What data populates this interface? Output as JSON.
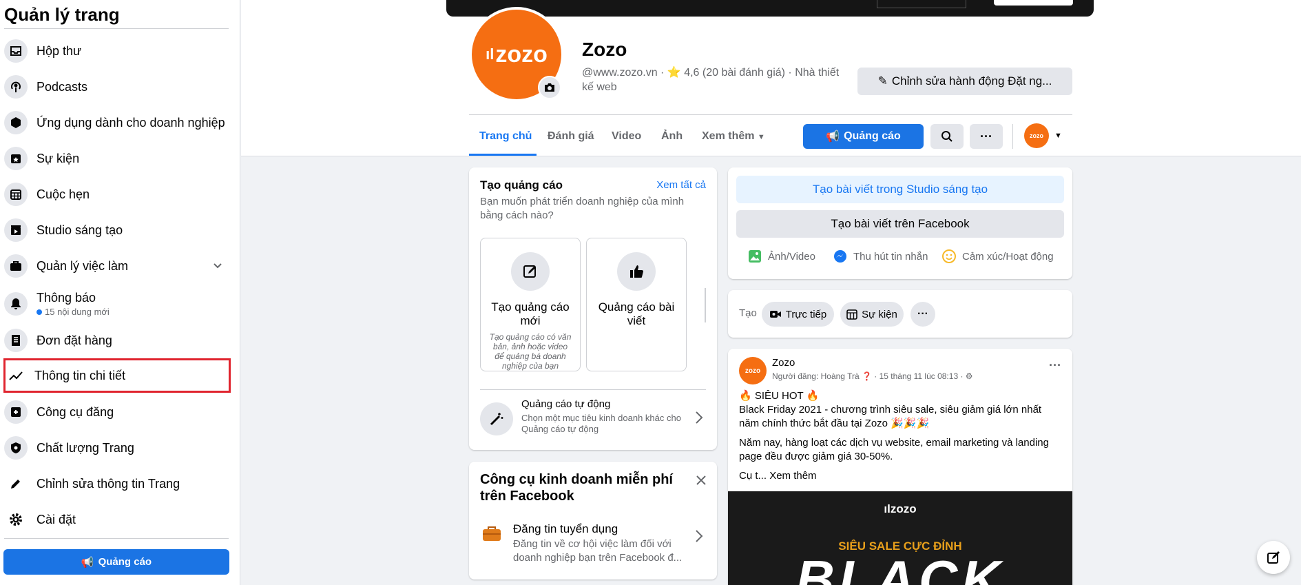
{
  "sidebar": {
    "title": "Quản lý trang",
    "items": [
      {
        "label": "Hộp thư"
      },
      {
        "label": "Podcasts"
      },
      {
        "label": "Ứng dụng dành cho doanh nghiệp"
      },
      {
        "label": "Sự kiện"
      },
      {
        "label": "Cuộc hẹn"
      },
      {
        "label": "Studio sáng tạo"
      },
      {
        "label": "Quản lý việc làm"
      },
      {
        "label": "Thông báo",
        "sub": "15 nội dung mới"
      },
      {
        "label": "Đơn đặt hàng"
      },
      {
        "label": "Thông tin chi tiết"
      },
      {
        "label": "Công cụ đăng"
      },
      {
        "label": "Chất lượng Trang"
      },
      {
        "label": "Chỉnh sửa thông tin Trang"
      },
      {
        "label": "Cài đặt"
      }
    ],
    "ad_button": "Quảng cáo"
  },
  "page": {
    "avatar_text": "zozo",
    "name": "Zozo",
    "subtitle_line1": "@www.zozo.vn · ⭐ 4,6 (20 bài đánh giá) · Nhà thiết",
    "subtitle_line2": "kế web",
    "edit_action": "Chỉnh sửa hành động Đặt ng..."
  },
  "tabs": [
    {
      "label": "Trang chủ"
    },
    {
      "label": "Đánh giá"
    },
    {
      "label": "Video"
    },
    {
      "label": "Ảnh"
    },
    {
      "label": "Xem thêm"
    }
  ],
  "header_ad_button": "Quảng cáo",
  "create_ad": {
    "title": "Tạo quảng cáo",
    "see_all": "Xem tất cả",
    "desc": "Bạn muốn phát triển doanh nghiệp của mình bằng cách nào?",
    "opt1_title": "Tạo quảng cáo mới",
    "opt1_desc": "Tạo quảng cáo có văn bản, ảnh hoặc video để quảng bá doanh nghiệp của bạn",
    "opt2_title": "Quảng cáo bài viết",
    "auto_title": "Quảng cáo tự động",
    "auto_desc": "Chọn một mục tiêu kinh doanh khác cho Quảng cáo tự động"
  },
  "tools": {
    "title": "Công cụ kinh doanh miễn phí trên Facebook",
    "item_title": "Đăng tin tuyển dụng",
    "item_desc": "Đăng tin về cơ hội việc làm đối với doanh nghiệp bạn trên Facebook đ..."
  },
  "composer": {
    "studio_btn": "Tạo bài viết trong Studio sáng tạo",
    "fb_btn": "Tạo bài viết trên Facebook",
    "photo": "Ảnh/Video",
    "messages": "Thu hút tin nhắn",
    "feeling": "Cảm xúc/Hoạt động"
  },
  "create_row": {
    "label": "Tạo",
    "live": "Trực tiếp",
    "event": "Sự kiện"
  },
  "post": {
    "author": "Zozo",
    "meta": "Người đăng: Hoàng Trà ❓ · 15 tháng 11 lúc 08:13 · ⚙",
    "line1": "🔥 SIÊU HOT 🔥",
    "line2": "Black Friday 2021 - chương trình siêu sale, siêu giảm giá lớn nhất năm chính thức bắt đầu tại Zozo 🎉🎉🎉",
    "line3": "Năm nay, hàng loạt các dịch vụ website, email marketing và landing page đều được giảm giá 30-50%.",
    "truncated": "Cụ t...",
    "see_more": "Xem thêm",
    "image_logo": "zozo",
    "image_sale": "SIÊU SALE CỰC ĐỈNH",
    "image_big": "BLACK"
  },
  "colors": {
    "accent": "#1877f2",
    "brand_orange": "#f56e12",
    "highlight_red": "#e0242e"
  }
}
